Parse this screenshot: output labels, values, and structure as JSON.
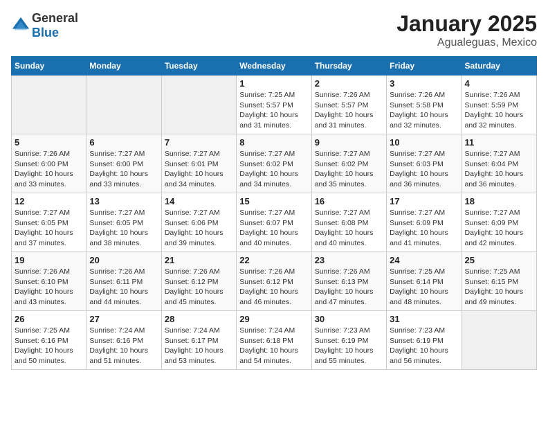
{
  "header": {
    "logo_general": "General",
    "logo_blue": "Blue",
    "month": "January 2025",
    "location": "Agualeguas, Mexico"
  },
  "days_of_week": [
    "Sunday",
    "Monday",
    "Tuesday",
    "Wednesday",
    "Thursday",
    "Friday",
    "Saturday"
  ],
  "weeks": [
    [
      {
        "day": "",
        "info": ""
      },
      {
        "day": "",
        "info": ""
      },
      {
        "day": "",
        "info": ""
      },
      {
        "day": "1",
        "info": "Sunrise: 7:25 AM\nSunset: 5:57 PM\nDaylight: 10 hours\nand 31 minutes."
      },
      {
        "day": "2",
        "info": "Sunrise: 7:26 AM\nSunset: 5:57 PM\nDaylight: 10 hours\nand 31 minutes."
      },
      {
        "day": "3",
        "info": "Sunrise: 7:26 AM\nSunset: 5:58 PM\nDaylight: 10 hours\nand 32 minutes."
      },
      {
        "day": "4",
        "info": "Sunrise: 7:26 AM\nSunset: 5:59 PM\nDaylight: 10 hours\nand 32 minutes."
      }
    ],
    [
      {
        "day": "5",
        "info": "Sunrise: 7:26 AM\nSunset: 6:00 PM\nDaylight: 10 hours\nand 33 minutes."
      },
      {
        "day": "6",
        "info": "Sunrise: 7:27 AM\nSunset: 6:00 PM\nDaylight: 10 hours\nand 33 minutes."
      },
      {
        "day": "7",
        "info": "Sunrise: 7:27 AM\nSunset: 6:01 PM\nDaylight: 10 hours\nand 34 minutes."
      },
      {
        "day": "8",
        "info": "Sunrise: 7:27 AM\nSunset: 6:02 PM\nDaylight: 10 hours\nand 34 minutes."
      },
      {
        "day": "9",
        "info": "Sunrise: 7:27 AM\nSunset: 6:02 PM\nDaylight: 10 hours\nand 35 minutes."
      },
      {
        "day": "10",
        "info": "Sunrise: 7:27 AM\nSunset: 6:03 PM\nDaylight: 10 hours\nand 36 minutes."
      },
      {
        "day": "11",
        "info": "Sunrise: 7:27 AM\nSunset: 6:04 PM\nDaylight: 10 hours\nand 36 minutes."
      }
    ],
    [
      {
        "day": "12",
        "info": "Sunrise: 7:27 AM\nSunset: 6:05 PM\nDaylight: 10 hours\nand 37 minutes."
      },
      {
        "day": "13",
        "info": "Sunrise: 7:27 AM\nSunset: 6:05 PM\nDaylight: 10 hours\nand 38 minutes."
      },
      {
        "day": "14",
        "info": "Sunrise: 7:27 AM\nSunset: 6:06 PM\nDaylight: 10 hours\nand 39 minutes."
      },
      {
        "day": "15",
        "info": "Sunrise: 7:27 AM\nSunset: 6:07 PM\nDaylight: 10 hours\nand 40 minutes."
      },
      {
        "day": "16",
        "info": "Sunrise: 7:27 AM\nSunset: 6:08 PM\nDaylight: 10 hours\nand 40 minutes."
      },
      {
        "day": "17",
        "info": "Sunrise: 7:27 AM\nSunset: 6:09 PM\nDaylight: 10 hours\nand 41 minutes."
      },
      {
        "day": "18",
        "info": "Sunrise: 7:27 AM\nSunset: 6:09 PM\nDaylight: 10 hours\nand 42 minutes."
      }
    ],
    [
      {
        "day": "19",
        "info": "Sunrise: 7:26 AM\nSunset: 6:10 PM\nDaylight: 10 hours\nand 43 minutes."
      },
      {
        "day": "20",
        "info": "Sunrise: 7:26 AM\nSunset: 6:11 PM\nDaylight: 10 hours\nand 44 minutes."
      },
      {
        "day": "21",
        "info": "Sunrise: 7:26 AM\nSunset: 6:12 PM\nDaylight: 10 hours\nand 45 minutes."
      },
      {
        "day": "22",
        "info": "Sunrise: 7:26 AM\nSunset: 6:12 PM\nDaylight: 10 hours\nand 46 minutes."
      },
      {
        "day": "23",
        "info": "Sunrise: 7:26 AM\nSunset: 6:13 PM\nDaylight: 10 hours\nand 47 minutes."
      },
      {
        "day": "24",
        "info": "Sunrise: 7:25 AM\nSunset: 6:14 PM\nDaylight: 10 hours\nand 48 minutes."
      },
      {
        "day": "25",
        "info": "Sunrise: 7:25 AM\nSunset: 6:15 PM\nDaylight: 10 hours\nand 49 minutes."
      }
    ],
    [
      {
        "day": "26",
        "info": "Sunrise: 7:25 AM\nSunset: 6:16 PM\nDaylight: 10 hours\nand 50 minutes."
      },
      {
        "day": "27",
        "info": "Sunrise: 7:24 AM\nSunset: 6:16 PM\nDaylight: 10 hours\nand 51 minutes."
      },
      {
        "day": "28",
        "info": "Sunrise: 7:24 AM\nSunset: 6:17 PM\nDaylight: 10 hours\nand 53 minutes."
      },
      {
        "day": "29",
        "info": "Sunrise: 7:24 AM\nSunset: 6:18 PM\nDaylight: 10 hours\nand 54 minutes."
      },
      {
        "day": "30",
        "info": "Sunrise: 7:23 AM\nSunset: 6:19 PM\nDaylight: 10 hours\nand 55 minutes."
      },
      {
        "day": "31",
        "info": "Sunrise: 7:23 AM\nSunset: 6:19 PM\nDaylight: 10 hours\nand 56 minutes."
      },
      {
        "day": "",
        "info": ""
      }
    ]
  ]
}
